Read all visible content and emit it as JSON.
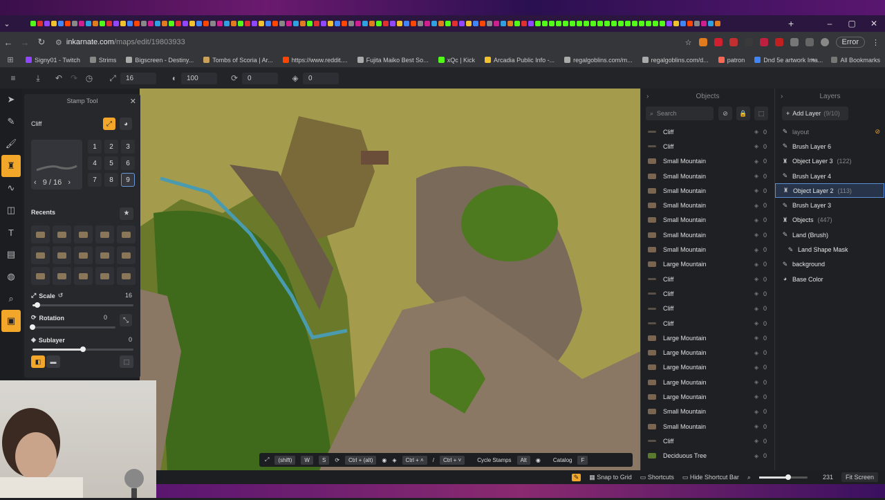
{
  "browser": {
    "url_host": "inkarnate.com",
    "url_path": "/maps/edit/19803933",
    "error_label": "Error",
    "bookmarks": [
      {
        "label": "Signy01 - Twitch",
        "color": "#9146ff"
      },
      {
        "label": "Strims",
        "color": "#888888"
      },
      {
        "label": "Bigscreen - Destiny...",
        "color": "#aaaaaa"
      },
      {
        "label": "Tombs of Scoria | Ar...",
        "color": "#c9a15a"
      },
      {
        "label": "https://www.reddit....",
        "color": "#ff4500"
      },
      {
        "label": "Fujita Maiko Best So...",
        "color": "#aaaaaa"
      },
      {
        "label": "xQc | Kick",
        "color": "#53fc18"
      },
      {
        "label": "Arcadia Public Info -...",
        "color": "#f2c12e"
      },
      {
        "label": "regalgoblins.com/m...",
        "color": "#aaaaaa"
      },
      {
        "label": "regalgoblins.com/d...",
        "color": "#aaaaaa"
      },
      {
        "label": "patron",
        "color": "#f96854"
      },
      {
        "label": "Dnd 5e artwork Ima...",
        "color": "#4285f4"
      }
    ],
    "all_bookmarks": "All Bookmarks"
  },
  "toolbar": {
    "size": "16",
    "opacity": "100",
    "rotation": "0",
    "layer": "0"
  },
  "stamp_panel": {
    "title": "Stamp Tool",
    "stamp_name": "Cliff",
    "pager": "9 / 16",
    "numbers": [
      "1",
      "2",
      "3",
      "4",
      "5",
      "6",
      "7",
      "8",
      "9"
    ],
    "selected_number": "9",
    "recents_label": "Recents",
    "scale": {
      "label": "Scale",
      "value": "16",
      "fraction": 0.05
    },
    "rotation": {
      "label": "Rotation",
      "value": "0",
      "fraction": 0.0
    },
    "sublayer": {
      "label": "Sublayer",
      "value": "0",
      "fraction": 0.5
    }
  },
  "shortcuts": {
    "shift": "(shift)",
    "w": "W",
    "s": "S",
    "ctrl_alt": "Ctrl + (alt)",
    "ctrl_up": "Ctrl + ˄",
    "ctrl_down": "Ctrl + ˅",
    "cycle_stamps": "Cycle Stamps",
    "alt": "Alt",
    "catalog": "Catalog",
    "f": "F"
  },
  "statusbar": {
    "snap": "Snap to Grid",
    "shortcuts": "Shortcuts",
    "hide_shortcut_bar": "Hide Shortcut Bar",
    "zoom": "231",
    "zoom_fraction": 0.6,
    "fit_screen": "Fit Screen"
  },
  "objects_panel": {
    "title": "Objects",
    "search_placeholder": "Search",
    "items": [
      {
        "name": "Cliff",
        "count": "0",
        "kind": "cliff"
      },
      {
        "name": "Cliff",
        "count": "0",
        "kind": "cliff"
      },
      {
        "name": "Small Mountain",
        "count": "0",
        "kind": "mountain"
      },
      {
        "name": "Small Mountain",
        "count": "0",
        "kind": "mountain"
      },
      {
        "name": "Small Mountain",
        "count": "0",
        "kind": "mountain"
      },
      {
        "name": "Small Mountain",
        "count": "0",
        "kind": "mountain"
      },
      {
        "name": "Small Mountain",
        "count": "0",
        "kind": "mountain"
      },
      {
        "name": "Small Mountain",
        "count": "0",
        "kind": "mountain"
      },
      {
        "name": "Small Mountain",
        "count": "0",
        "kind": "mountain"
      },
      {
        "name": "Large Mountain",
        "count": "0",
        "kind": "mountain"
      },
      {
        "name": "Cliff",
        "count": "0",
        "kind": "cliff"
      },
      {
        "name": "Cliff",
        "count": "0",
        "kind": "cliff"
      },
      {
        "name": "Cliff",
        "count": "0",
        "kind": "cliff"
      },
      {
        "name": "Cliff",
        "count": "0",
        "kind": "cliff"
      },
      {
        "name": "Large Mountain",
        "count": "0",
        "kind": "mountain"
      },
      {
        "name": "Large Mountain",
        "count": "0",
        "kind": "mountain"
      },
      {
        "name": "Large Mountain",
        "count": "0",
        "kind": "mountain"
      },
      {
        "name": "Large Mountain",
        "count": "0",
        "kind": "mountain"
      },
      {
        "name": "Large Mountain",
        "count": "0",
        "kind": "mountain"
      },
      {
        "name": "Small Mountain",
        "count": "0",
        "kind": "mountain"
      },
      {
        "name": "Small Mountain",
        "count": "0",
        "kind": "mountain"
      },
      {
        "name": "Cliff",
        "count": "0",
        "kind": "cliff"
      },
      {
        "name": "Deciduous Tree",
        "count": "0",
        "kind": "tree"
      }
    ]
  },
  "layers_panel": {
    "title": "Layers",
    "add_layer": "Add Layer",
    "add_layer_count": "(9/10)",
    "items": [
      {
        "name": "layout",
        "count": "",
        "dim": true
      },
      {
        "name": "Brush Layer 6",
        "count": ""
      },
      {
        "name": "Object Layer 3",
        "count": "(122)"
      },
      {
        "name": "Brush Layer 4",
        "count": ""
      },
      {
        "name": "Object Layer 2",
        "count": "(113)",
        "selected": true
      },
      {
        "name": "Brush Layer 3",
        "count": ""
      },
      {
        "name": "Objects",
        "count": "(447)"
      },
      {
        "name": "Land (Brush)",
        "count": ""
      },
      {
        "name": "Land Shape Mask",
        "count": "",
        "sub": true
      },
      {
        "name": "background",
        "count": ""
      },
      {
        "name": "Base Color",
        "count": ""
      }
    ]
  },
  "colors": {
    "accent": "#f2a62a",
    "selection": "#5b8fd8"
  }
}
